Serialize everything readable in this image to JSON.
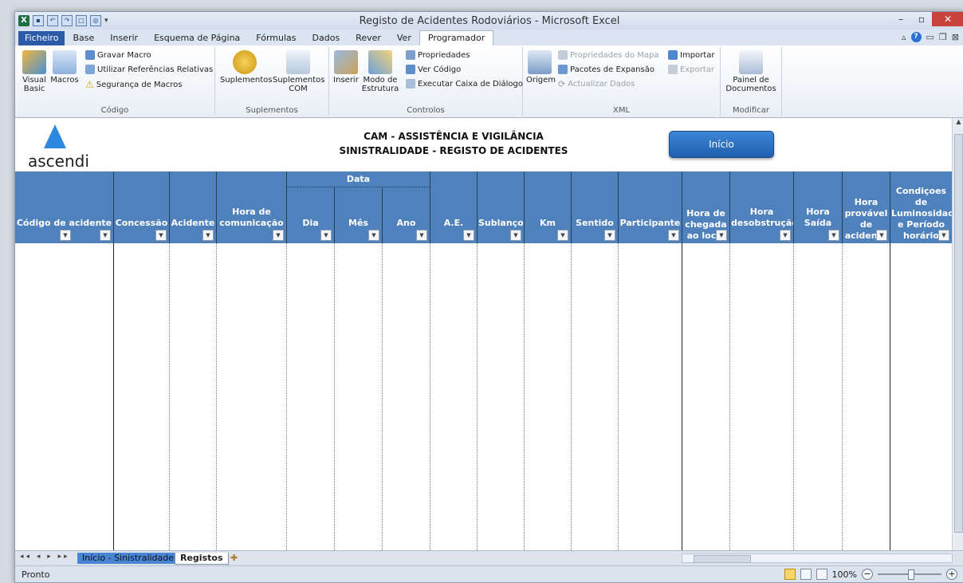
{
  "window": {
    "title": "Registo de Acidentes Rodoviários - Microsoft Excel",
    "min": "–",
    "max": "▫",
    "close": "✕"
  },
  "tabs": {
    "file": "Ficheiro",
    "items": [
      "Base",
      "Inserir",
      "Esquema de Página",
      "Fórmulas",
      "Dados",
      "Rever",
      "Ver"
    ],
    "active": "Programador"
  },
  "ribbon": {
    "codigo": {
      "label": "Código",
      "visual_basic": "Visual Basic",
      "macros": "Macros",
      "gravar": "Gravar Macro",
      "referencias": "Utilizar Referências Relativas",
      "seguranca": "Segurança de Macros"
    },
    "suplementos": {
      "label": "Suplementos",
      "suplementos": "Suplementos",
      "com": "Suplementos COM"
    },
    "controlos": {
      "label": "Controlos",
      "inserir": "Inserir",
      "modo": "Modo de Estrutura",
      "propriedades": "Propriedades",
      "ver_codigo": "Ver Código",
      "executar": "Executar Caixa de Diálogo"
    },
    "xml": {
      "label": "XML",
      "origem": "Origem",
      "prop_mapa": "Propriedades do Mapa",
      "pacotes": "Pacotes de Expansão",
      "actualizar": "Actualizar Dados",
      "importar": "Importar",
      "exportar": "Exportar"
    },
    "modificar": {
      "label": "Modificar",
      "painel": "Painel de Documentos"
    }
  },
  "sheet": {
    "logo": "ascendi",
    "title_line1": "CAM - ASSISTÊNCIA E VIGILÂNCIA",
    "title_line2": "SINISTRALIDADE - REGISTO DE ACIDENTES",
    "button": "Início",
    "date_group": "Data",
    "columns": [
      "Código de acidente",
      "Concessão",
      "Acidente",
      "Hora de comunicação",
      "Dia",
      "Mês",
      "Ano",
      "A.E.",
      "Sublanço",
      "Km",
      "Sentido",
      "Participante",
      "Hora de chegada ao local",
      "Hora desobstrução",
      "Hora Saída",
      "Hora provável de acidente",
      "Condiçoes de Luminosidade e Período horário"
    ]
  },
  "sheet_tabs": [
    "Início - Sinistralidade",
    "Registos"
  ],
  "status": {
    "ready": "Pronto",
    "zoom": "100%"
  }
}
